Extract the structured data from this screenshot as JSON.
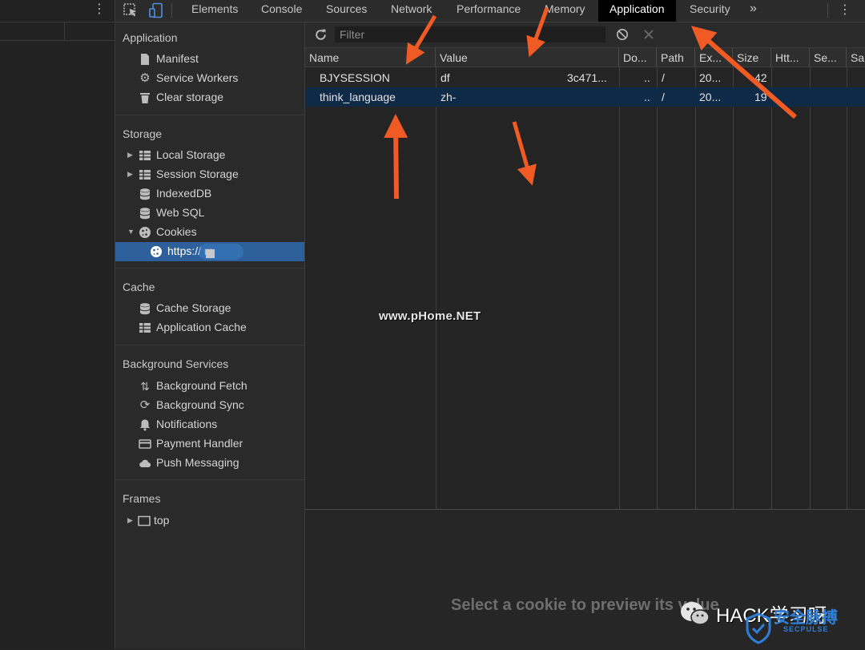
{
  "tabs": [
    "Elements",
    "Console",
    "Sources",
    "Network",
    "Performance",
    "Memory",
    "Application",
    "Security"
  ],
  "tabs_overflow": "»",
  "sidebar": {
    "application": {
      "title": "Application",
      "items": [
        {
          "label": "Manifest",
          "icon": "file-icon"
        },
        {
          "label": "Service Workers",
          "icon": "gear-icon"
        },
        {
          "label": "Clear storage",
          "icon": "trash-icon"
        }
      ]
    },
    "storage": {
      "title": "Storage",
      "items": [
        {
          "label": "Local Storage",
          "icon": "grid-icon"
        },
        {
          "label": "Session Storage",
          "icon": "grid-icon"
        },
        {
          "label": "IndexedDB",
          "icon": "database-icon"
        },
        {
          "label": "Web SQL",
          "icon": "database-icon"
        },
        {
          "label": "Cookies",
          "icon": "cookie-icon"
        },
        {
          "label": "https://          m",
          "icon": "cookie-icon"
        }
      ]
    },
    "cache": {
      "title": "Cache",
      "items": [
        {
          "label": "Cache Storage",
          "icon": "database-icon"
        },
        {
          "label": "Application Cache",
          "icon": "grid-icon"
        }
      ]
    },
    "background": {
      "title": "Background Services",
      "items": [
        {
          "label": "Background Fetch",
          "icon": "arrows-updown-icon"
        },
        {
          "label": "Background Sync",
          "icon": "sync-icon"
        },
        {
          "label": "Notifications",
          "icon": "bell-icon"
        },
        {
          "label": "Payment Handler",
          "icon": "card-icon"
        },
        {
          "label": "Push Messaging",
          "icon": "cloud-icon"
        }
      ]
    },
    "frames": {
      "title": "Frames",
      "items": [
        {
          "label": "top",
          "icon": "frame-icon"
        }
      ]
    }
  },
  "toolbar": {
    "filter_placeholder": "Filter"
  },
  "table": {
    "headers": [
      "Name",
      "Value",
      "Do...",
      "Path",
      "Ex...",
      "Size",
      "Htt...",
      "Se...",
      "Sa"
    ],
    "rows": [
      {
        "name": "BJYSESSION",
        "value": "df",
        "value_tail": "3c471...",
        "domain": "..",
        "path": "/",
        "expires": "20...",
        "size": "42"
      },
      {
        "name": "think_language",
        "value": "zh-",
        "value_tail": "",
        "domain": "..",
        "path": "/",
        "expires": "20...",
        "size": "19"
      }
    ]
  },
  "preview": {
    "text": "Select a cookie to preview its value"
  },
  "watermark": "www.pHome.NET",
  "overlay_logo": {
    "text": "HACK学习呀",
    "brand": "安全脉搏",
    "brand_sub": "SECPULSE"
  },
  "colors": {
    "annotation_arrow": "#f05a24",
    "selection": "#2d5f9a",
    "selected_row": "#0f2a47"
  }
}
